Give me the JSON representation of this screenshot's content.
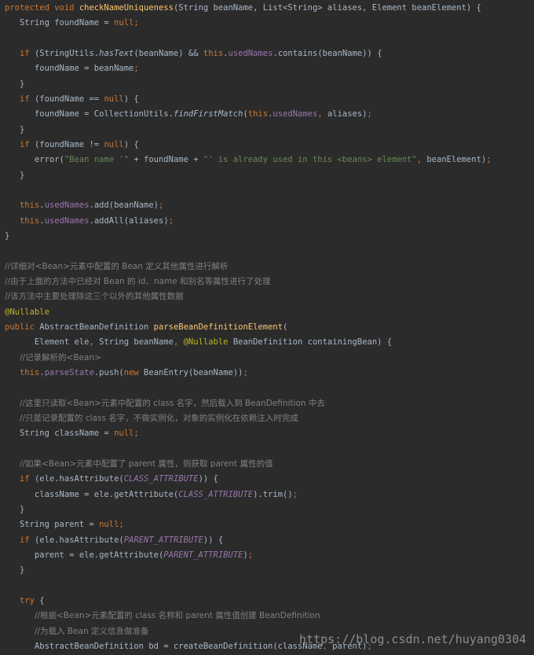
{
  "editor": {
    "background": "#2b2b2b",
    "syntax_colors": {
      "default": "#a9b7c6",
      "keyword": "#cc7832",
      "method_declaration": "#ffc66d",
      "field": "#9876aa",
      "string": "#6a8759",
      "comment": "#808080",
      "annotation": "#bbb529"
    },
    "lines": [
      [
        {
          "t": "kw",
          "v": "protected void "
        },
        {
          "t": "fn",
          "v": "checkNameUniqueness"
        },
        {
          "t": "",
          "v": "(String beanName, List<String> aliases, Element beanElement) {"
        }
      ],
      [
        {
          "t": "",
          "v": "   String foundName = "
        },
        {
          "t": "kw",
          "v": "null"
        },
        {
          "t": "kw",
          "v": ";"
        }
      ],
      [],
      [
        {
          "t": "",
          "v": "   "
        },
        {
          "t": "kw",
          "v": "if "
        },
        {
          "t": "",
          "v": "(StringUtils."
        },
        {
          "t": "ital",
          "v": "hasText"
        },
        {
          "t": "",
          "v": "(beanName) && "
        },
        {
          "t": "kw",
          "v": "this"
        },
        {
          "t": "",
          "v": "."
        },
        {
          "t": "fld",
          "v": "usedNames"
        },
        {
          "t": "",
          "v": ".contains(beanName)) {"
        }
      ],
      [
        {
          "t": "",
          "v": "      foundName = beanName"
        },
        {
          "t": "kw",
          "v": ";"
        }
      ],
      [
        {
          "t": "",
          "v": "   }"
        }
      ],
      [
        {
          "t": "",
          "v": "   "
        },
        {
          "t": "kw",
          "v": "if "
        },
        {
          "t": "",
          "v": "(foundName == "
        },
        {
          "t": "kw",
          "v": "null"
        },
        {
          "t": "",
          "v": ") {"
        }
      ],
      [
        {
          "t": "",
          "v": "      foundName = CollectionUtils."
        },
        {
          "t": "ital",
          "v": "findFirstMatch"
        },
        {
          "t": "",
          "v": "("
        },
        {
          "t": "kw",
          "v": "this"
        },
        {
          "t": "",
          "v": "."
        },
        {
          "t": "fld",
          "v": "usedNames"
        },
        {
          "t": "kw",
          "v": ", "
        },
        {
          "t": "",
          "v": "aliases)"
        },
        {
          "t": "kw",
          "v": ";"
        }
      ],
      [
        {
          "t": "",
          "v": "   }"
        }
      ],
      [
        {
          "t": "",
          "v": "   "
        },
        {
          "t": "kw",
          "v": "if "
        },
        {
          "t": "",
          "v": "(foundName != "
        },
        {
          "t": "kw",
          "v": "null"
        },
        {
          "t": "",
          "v": ") {"
        }
      ],
      [
        {
          "t": "",
          "v": "      error("
        },
        {
          "t": "str",
          "v": "\"Bean name '\""
        },
        {
          "t": "",
          "v": " + foundName + "
        },
        {
          "t": "str",
          "v": "\"' is already used in this <beans> element\""
        },
        {
          "t": "kw",
          "v": ", "
        },
        {
          "t": "",
          "v": "beanElement)"
        },
        {
          "t": "kw",
          "v": ";"
        }
      ],
      [
        {
          "t": "",
          "v": "   }"
        }
      ],
      [],
      [
        {
          "t": "",
          "v": "   "
        },
        {
          "t": "kw",
          "v": "this"
        },
        {
          "t": "",
          "v": "."
        },
        {
          "t": "fld",
          "v": "usedNames"
        },
        {
          "t": "",
          "v": ".add(beanName)"
        },
        {
          "t": "kw",
          "v": ";"
        }
      ],
      [
        {
          "t": "",
          "v": "   "
        },
        {
          "t": "kw",
          "v": "this"
        },
        {
          "t": "",
          "v": "."
        },
        {
          "t": "fld",
          "v": "usedNames"
        },
        {
          "t": "",
          "v": ".addAll(aliases)"
        },
        {
          "t": "kw",
          "v": ";"
        }
      ],
      [
        {
          "t": "",
          "v": "}"
        }
      ],
      [],
      [
        {
          "t": "cmt",
          "v": "//详细对<Bean>元素中配置的 Bean 定义其他属性进行解析"
        }
      ],
      [
        {
          "t": "cmt",
          "v": "//由于上面的方法中已经对 Bean 的 id、name 和别名等属性进行了处理"
        }
      ],
      [
        {
          "t": "cmt",
          "v": "//该方法中主要处理除这三个以外的其他属性数据"
        }
      ],
      [
        {
          "t": "ann",
          "v": "@Nullable"
        }
      ],
      [
        {
          "t": "kw",
          "v": "public "
        },
        {
          "t": "",
          "v": "AbstractBeanDefinition "
        },
        {
          "t": "fn",
          "v": "parseBeanDefinitionElement"
        },
        {
          "t": "",
          "v": "("
        }
      ],
      [
        {
          "t": "",
          "v": "      Element ele"
        },
        {
          "t": "kw",
          "v": ", "
        },
        {
          "t": "",
          "v": "String beanName"
        },
        {
          "t": "kw",
          "v": ", "
        },
        {
          "t": "ann",
          "v": "@Nullable "
        },
        {
          "t": "",
          "v": "BeanDefinition containingBean) {"
        }
      ],
      [
        {
          "t": "",
          "v": "   "
        },
        {
          "t": "cmt",
          "v": "//记录解析的<Bean>"
        }
      ],
      [
        {
          "t": "",
          "v": "   "
        },
        {
          "t": "kw",
          "v": "this"
        },
        {
          "t": "",
          "v": "."
        },
        {
          "t": "fld",
          "v": "parseState"
        },
        {
          "t": "",
          "v": ".push("
        },
        {
          "t": "kw",
          "v": "new "
        },
        {
          "t": "",
          "v": "BeanEntry(beanName))"
        },
        {
          "t": "kw",
          "v": ";"
        }
      ],
      [],
      [
        {
          "t": "",
          "v": "   "
        },
        {
          "t": "cmt",
          "v": "//这里只读取<Bean>元素中配置的 class 名字，然后载入到 BeanDefinition 中去"
        }
      ],
      [
        {
          "t": "",
          "v": "   "
        },
        {
          "t": "cmt",
          "v": "//只是记录配置的 class 名字，不做实例化，对象的实例化在依赖注入时完成"
        }
      ],
      [
        {
          "t": "",
          "v": "   String className = "
        },
        {
          "t": "kw",
          "v": "null"
        },
        {
          "t": "kw",
          "v": ";"
        }
      ],
      [],
      [
        {
          "t": "",
          "v": "   "
        },
        {
          "t": "cmt",
          "v": "//如果<Bean>元素中配置了 parent 属性，则获取 parent 属性的值"
        }
      ],
      [
        {
          "t": "",
          "v": "   "
        },
        {
          "t": "kw",
          "v": "if "
        },
        {
          "t": "",
          "v": "(ele.hasAttribute("
        },
        {
          "t": "const",
          "v": "CLASS_ATTRIBUTE"
        },
        {
          "t": "",
          "v": ")) {"
        }
      ],
      [
        {
          "t": "",
          "v": "      className = ele.getAttribute("
        },
        {
          "t": "const",
          "v": "CLASS_ATTRIBUTE"
        },
        {
          "t": "",
          "v": ").trim()"
        },
        {
          "t": "kw",
          "v": ";"
        }
      ],
      [
        {
          "t": "",
          "v": "   }"
        }
      ],
      [
        {
          "t": "",
          "v": "   String parent = "
        },
        {
          "t": "kw",
          "v": "null"
        },
        {
          "t": "kw",
          "v": ";"
        }
      ],
      [
        {
          "t": "",
          "v": "   "
        },
        {
          "t": "kw",
          "v": "if "
        },
        {
          "t": "",
          "v": "(ele.hasAttribute("
        },
        {
          "t": "const",
          "v": "PARENT_ATTRIBUTE"
        },
        {
          "t": "",
          "v": ")) {"
        }
      ],
      [
        {
          "t": "",
          "v": "      parent = ele.getAttribute("
        },
        {
          "t": "const",
          "v": "PARENT_ATTRIBUTE"
        },
        {
          "t": "",
          "v": ")"
        },
        {
          "t": "kw",
          "v": ";"
        }
      ],
      [
        {
          "t": "",
          "v": "   }"
        }
      ],
      [],
      [
        {
          "t": "",
          "v": "   "
        },
        {
          "t": "kw",
          "v": "try "
        },
        {
          "t": "",
          "v": "{"
        }
      ],
      [
        {
          "t": "",
          "v": "      "
        },
        {
          "t": "cmt",
          "v": "//根据<Bean>元素配置的 class 名称和 parent 属性值创建 BeanDefinition"
        }
      ],
      [
        {
          "t": "",
          "v": "      "
        },
        {
          "t": "cmt",
          "v": "//为载入 Bean 定义信息做准备"
        }
      ],
      [
        {
          "t": "",
          "v": "      AbstractBeanDefinition bd = createBeanDefinition(className"
        },
        {
          "t": "kw",
          "v": ", "
        },
        {
          "t": "",
          "v": "parent)"
        },
        {
          "t": "kw",
          "v": ";"
        }
      ]
    ]
  },
  "watermark": {
    "text": "https://blog.csdn.net/huyang0304"
  }
}
